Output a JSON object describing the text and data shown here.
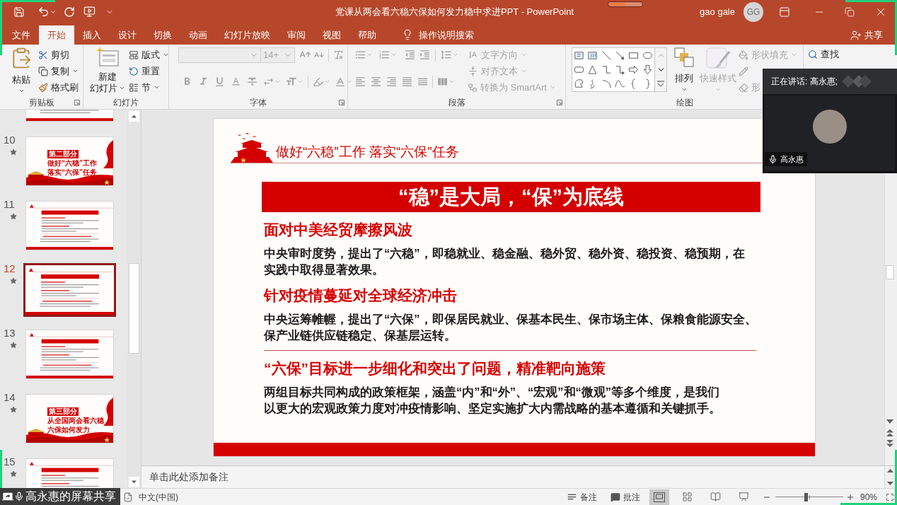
{
  "title_bar": {
    "title": "党课从两会看六稳六保如何发力稳中求进PPT - PowerPoint",
    "user": "gao gale",
    "avatar": "GG"
  },
  "tabs": [
    {
      "label": "文件",
      "selected": false
    },
    {
      "label": "开始",
      "selected": true
    },
    {
      "label": "插入",
      "selected": false
    },
    {
      "label": "设计",
      "selected": false
    },
    {
      "label": "切换",
      "selected": false
    },
    {
      "label": "动画",
      "selected": false
    },
    {
      "label": "幻灯片放映",
      "selected": false
    },
    {
      "label": "审阅",
      "selected": false
    },
    {
      "label": "视图",
      "selected": false
    },
    {
      "label": "帮助",
      "selected": false
    }
  ],
  "tell_me": "操作说明搜索",
  "share": "共享",
  "ribbon": {
    "clipboard": {
      "label": "剪贴板",
      "paste": "粘贴",
      "cut": "剪切",
      "copy": "复制",
      "format_painter": "格式刷"
    },
    "slides": {
      "label": "幻灯片",
      "new_slide": [
        "新建",
        "幻灯片"
      ],
      "layout": "版式",
      "reset": "重置",
      "section": "节"
    },
    "font": {
      "label": "字体",
      "size": "14+",
      "disabled": true
    },
    "paragraph": {
      "label": "段落",
      "text_direction": "文字方向",
      "align_text": "对齐文本",
      "smartart": "转换为 SmartArt",
      "disabled": true
    },
    "drawing": {
      "label": "绘图",
      "arrange": {
        "label": "排列",
        "disabled": false
      },
      "quick_styles": {
        "label": "快速样式",
        "disabled": true
      },
      "shape_fill": {
        "label": "形状填充",
        "disabled": true
      },
      "shape_outline": {
        "disabled": true
      },
      "shape_effects": {
        "label": "形",
        "disabled": true
      }
    },
    "editing": {
      "find": "查找"
    }
  },
  "thumbnails": [
    {
      "kind": "content",
      "selected": false
    },
    {
      "number": "10",
      "kind": "section",
      "selected": false,
      "tag": "第二部分",
      "lines": [
        "做好“六稳”工作",
        "落实“六保”任务"
      ]
    },
    {
      "number": "11",
      "kind": "content",
      "selected": false
    },
    {
      "number": "12",
      "kind": "content",
      "selected": true
    },
    {
      "number": "13",
      "kind": "content",
      "selected": false
    },
    {
      "number": "14",
      "kind": "section",
      "selected": false,
      "tag": "第三部分",
      "lines": [
        "从全国两会看六稳",
        "六保如何发力"
      ]
    },
    {
      "number": "15",
      "kind": "content",
      "selected": false
    }
  ],
  "slide": {
    "header": "做好“六稳”工作 落实“六保”任务",
    "banner": "“稳”是大局，“保”为底线",
    "sections": [
      {
        "kind": "heading",
        "text": "面对中美经贸摩擦风波"
      },
      {
        "kind": "paragraph",
        "text": "中央审时度势，提出了“六稳”，即稳就业、稳金融、稳外贸、稳外资、稳投资、稳预期，在实践中取得显著效果。"
      },
      {
        "kind": "heading",
        "text": "针对疫情蔓延对全球经济冲击"
      },
      {
        "kind": "paragraph",
        "text": "中央运筹帷幄，提出了“六保”，即保居民就业、保基本民生、保市场主体、保粮食能源安全、保产业链供应链稳定、保基层运转。"
      },
      {
        "kind": "divider"
      },
      {
        "kind": "heading",
        "text": "“六保”目标进一步细化和突出了问题，精准靶向施策"
      },
      {
        "kind": "paragraph",
        "text": "两组目标共同构成的政策框架，涵盖“内”和“外”、“宏观”和“微观”等多个维度，是我们以更大的宏观政策力度对冲疫情影响、坚定实施扩大内需战略的基本遵循和关键抓手。"
      }
    ]
  },
  "notes": {
    "placeholder": "单击此处添加备注"
  },
  "status_bar": {
    "language": "中文(中国)",
    "notes": "备注",
    "comments": "批注",
    "views": [
      {
        "kind": "normal",
        "selected": true
      },
      {
        "kind": "sorter",
        "selected": false
      },
      {
        "kind": "reading",
        "selected": false
      },
      {
        "kind": "slideshow",
        "selected": false
      }
    ],
    "zoom": {
      "level": 0.45,
      "reading": "90%"
    }
  },
  "meeting": {
    "speaking": "正在讲话: 高永惠;",
    "participant": "高永惠",
    "share_label": "高永惠的屏幕共享"
  }
}
